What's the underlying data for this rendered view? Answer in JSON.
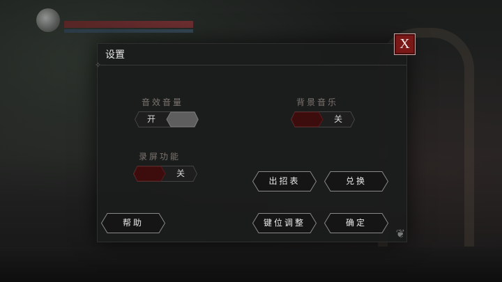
{
  "dialog": {
    "title": "设置",
    "close_label": "X"
  },
  "options": {
    "sfx": {
      "label": "音效音量",
      "on_label": "开",
      "state": "on"
    },
    "bgm": {
      "label": "背景音乐",
      "off_label": "关",
      "state": "off"
    },
    "record": {
      "label": "录屏功能",
      "off_label": "关",
      "state": "off"
    }
  },
  "buttons": {
    "moves": "出招表",
    "redeem": "兑换",
    "help": "帮助",
    "keymap": "键位调整",
    "confirm": "确定"
  },
  "colors": {
    "accent_red": "#7a1717",
    "toggle_on": "#5e5e5e",
    "toggle_off": "#3d0c0d"
  }
}
